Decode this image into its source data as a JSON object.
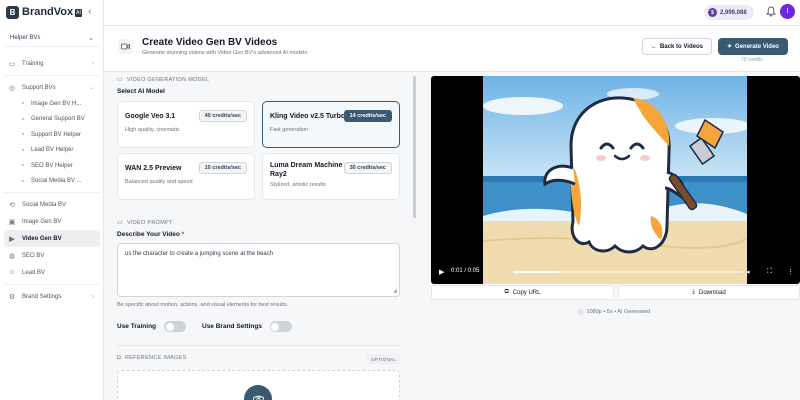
{
  "brand": {
    "name": "BrandVox",
    "badge": "AI",
    "logo_letter": "B"
  },
  "workspace": {
    "selected": "Helper BVs"
  },
  "sidebar": {
    "items": [
      {
        "label": "Training",
        "icon": "book-icon"
      },
      {
        "label": "Support BVs",
        "icon": "support-icon"
      },
      {
        "label": "Image Gen BV H...",
        "icon": "doc-icon"
      },
      {
        "label": "General Support BV",
        "icon": "doc-icon"
      },
      {
        "label": "Support BV Helper",
        "icon": "doc-icon"
      },
      {
        "label": "Lead BV Helper",
        "icon": "doc-icon"
      },
      {
        "label": "SEO BV Helper",
        "icon": "doc-icon"
      },
      {
        "label": "Social Media BV ...",
        "icon": "doc-icon"
      },
      {
        "label": "Social Media BV",
        "icon": "share-icon"
      },
      {
        "label": "Image Gen BV",
        "icon": "image-icon"
      },
      {
        "label": "Video Gen BV",
        "icon": "video-icon"
      },
      {
        "label": "SEO BV",
        "icon": "globe-icon"
      },
      {
        "label": "Lead BV",
        "icon": "user-icon"
      },
      {
        "label": "Brand Settings",
        "icon": "gear-icon"
      }
    ]
  },
  "topbar": {
    "credits": "2,999,088",
    "avatar_letter": "I"
  },
  "header": {
    "title": "Create Video Gen BV Videos",
    "subtitle": "Generate stunning videos with Video Gen BV's advanced AI models",
    "back_label": "Back to Videos",
    "generate_label": "Generate Video",
    "generate_credits": "70 credits"
  },
  "form": {
    "model_section": "VIDEO GENERATION MODEL",
    "select_label": "Select AI Model",
    "models": [
      {
        "name": "Google Veo 3.1",
        "desc": "High quality, cinematic",
        "credits": "40 credits/sec",
        "selected": false
      },
      {
        "name": "Kling Video v2.5 Turbo",
        "desc": "Fast generation",
        "credits": "14 credits/sec",
        "selected": true
      },
      {
        "name": "WAN 2.5 Preview",
        "desc": "Balanced quality and speed",
        "credits": "10 credits/sec",
        "selected": false
      },
      {
        "name": "Luma Dream Machine Ray2",
        "desc": "Stylized, artistic results",
        "credits": "30 credits/sec",
        "selected": false
      }
    ],
    "prompt_section": "VIDEO PROMPT",
    "describe_label": "Describe Your Video",
    "required_mark": "*",
    "prompt_value": "us the character to create a jumping scene at the beach",
    "hint": "Be specific about motion, actions, and visual elements for best results.",
    "use_training_label": "Use Training",
    "use_training": false,
    "use_brand_label": "Use Brand Settings",
    "use_brand": false,
    "reference_section": "REFERENCE IMAGES",
    "optional_label": "OPTIONAL"
  },
  "player": {
    "time": "0:01 / 0:05",
    "progress": 0.2,
    "copy_label": "Copy URL",
    "download_label": "Download",
    "meta": "1080p • 5s • AI Generated"
  },
  "colors": {
    "accent": "#3a5a72",
    "brand_purple": "#6d28d9",
    "sand": "#f1dcb0",
    "sea": "#3f8fc9"
  }
}
